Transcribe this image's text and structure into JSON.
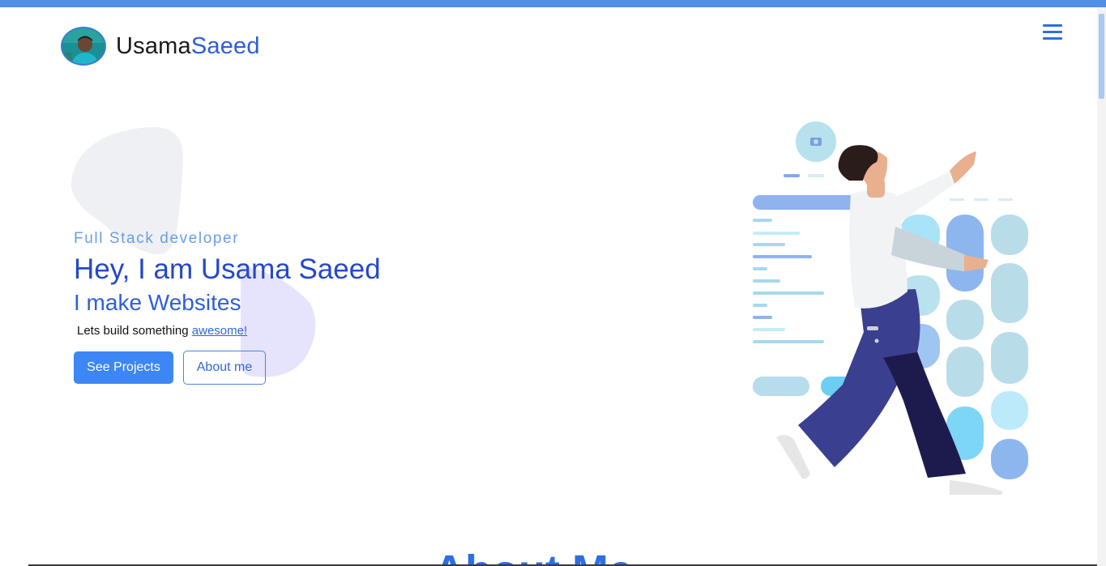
{
  "brand": {
    "first": "Usama",
    "last": "Saeed",
    "avatar_alt": "profile photo"
  },
  "nav": {
    "menu_icon": "hamburger-menu-icon"
  },
  "hero": {
    "subtitle": "Full Stack developer",
    "headline": "Hey, I am Usama Saeed",
    "subheadline": "I make Websites",
    "tagline_prefix": "Lets build something ",
    "tagline_link": "awesome!",
    "primary_button": "See Projects",
    "secondary_button": "About me"
  },
  "next_section": {
    "heading": "About Me"
  },
  "colors": {
    "accent": "#2d5ed6",
    "primary_button": "#3d86f5",
    "top_bar": "#4f8fe8"
  }
}
